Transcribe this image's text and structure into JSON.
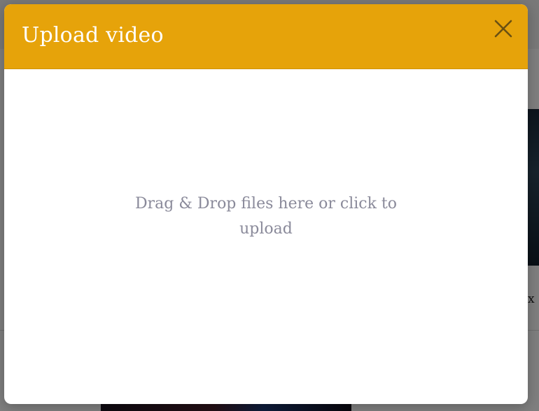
{
  "modal": {
    "title": "Upload video",
    "close_icon": "close-icon",
    "dropzone_text": "Drag & Drop files here or click to upload"
  },
  "background": {
    "right_char": "x"
  },
  "colors": {
    "header": "#e6a30a",
    "dropzone_text": "#8a8a9a",
    "overlay": "rgba(0,0,0,0.5)"
  }
}
